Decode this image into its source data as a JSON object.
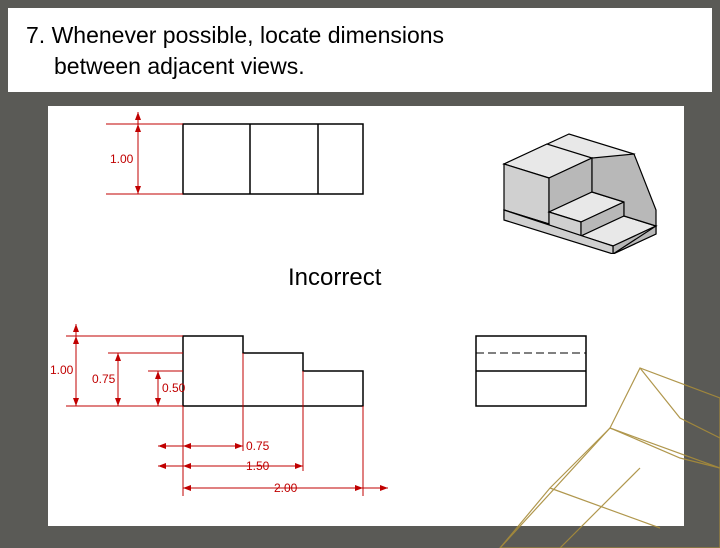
{
  "header": {
    "line1": "7. Whenever possible, locate dimensions",
    "line2": "between adjacent views."
  },
  "label": {
    "incorrect": "Incorrect"
  },
  "dims": {
    "top_height": "1.00",
    "front_total_h": "1.00",
    "front_step_h": "0.75",
    "front_step2_h": "0.50",
    "step_x1": "0.75",
    "step_x2": "1.50",
    "total_w": "2.00"
  },
  "chart_data": {
    "type": "table",
    "title": "Engineering dimensioning rule illustration — dimensions should lie between adjacent orthographic views; this figure is the INCORRECT example",
    "part": {
      "description": "Stepped block with two risers",
      "overall_width": 2.0,
      "overall_depth": 1.0,
      "overall_height": 1.0,
      "step_widths_from_left": [
        0.75,
        1.5,
        2.0
      ],
      "step_heights_from_base": [
        1.0,
        0.75,
        0.5
      ]
    },
    "views": [
      "top",
      "front",
      "right-side",
      "isometric"
    ],
    "dimensions_shown": [
      {
        "view": "top",
        "feature": "depth",
        "value": 1.0,
        "placement": "left of view",
        "ok": false
      },
      {
        "view": "front",
        "feature": "overall height",
        "value": 1.0,
        "placement": "left of view",
        "ok": false
      },
      {
        "view": "front",
        "feature": "first step height",
        "value": 0.75,
        "placement": "left of view",
        "ok": false
      },
      {
        "view": "front",
        "feature": "second step height",
        "value": 0.5,
        "placement": "left of view",
        "ok": false
      },
      {
        "view": "front",
        "feature": "first step width",
        "value": 0.75,
        "placement": "below view",
        "ok": false
      },
      {
        "view": "front",
        "feature": "second step width",
        "value": 1.5,
        "placement": "below view",
        "ok": false
      },
      {
        "view": "front",
        "feature": "overall width",
        "value": 2.0,
        "placement": "below view",
        "ok": false
      }
    ]
  }
}
